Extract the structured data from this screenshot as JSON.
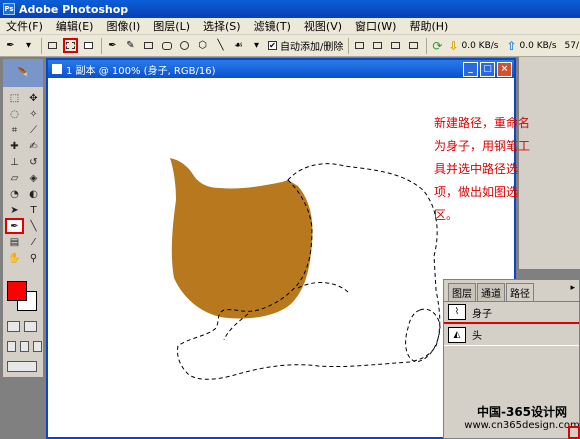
{
  "app": {
    "title": "Adobe Photoshop"
  },
  "menu": [
    "文件(F)",
    "编辑(E)",
    "图像(I)",
    "图层(L)",
    "选择(S)",
    "滤镜(T)",
    "视图(V)",
    "窗口(W)",
    "帮助(H)"
  ],
  "options": {
    "auto_add_delete_label": "自动添加/删除",
    "auto_add_delete_checked": true,
    "download_speed": "0.0 KB/s",
    "upload_speed": "0.0 KB/s",
    "right_edge_text": "57/"
  },
  "document": {
    "title": "1 副本 @ 100% (身子, RGB/16)"
  },
  "annotation": {
    "text": "新建路径，重命名为身子，用钢笔工具并选中路径选项，做出如图选区。"
  },
  "panel": {
    "tabs": [
      "图层",
      "通道",
      "路径"
    ],
    "active_tab": "路径",
    "paths": [
      {
        "name": "身子",
        "selected": true
      },
      {
        "name": "头",
        "selected": false
      }
    ]
  },
  "watermark": {
    "line1": "中国-365设计网",
    "line2": "www.cn365design.com"
  },
  "colors": {
    "foreground": "#ff0000",
    "background": "#ffffff",
    "head_fill": "#b8791e",
    "highlight": "#e00000"
  }
}
